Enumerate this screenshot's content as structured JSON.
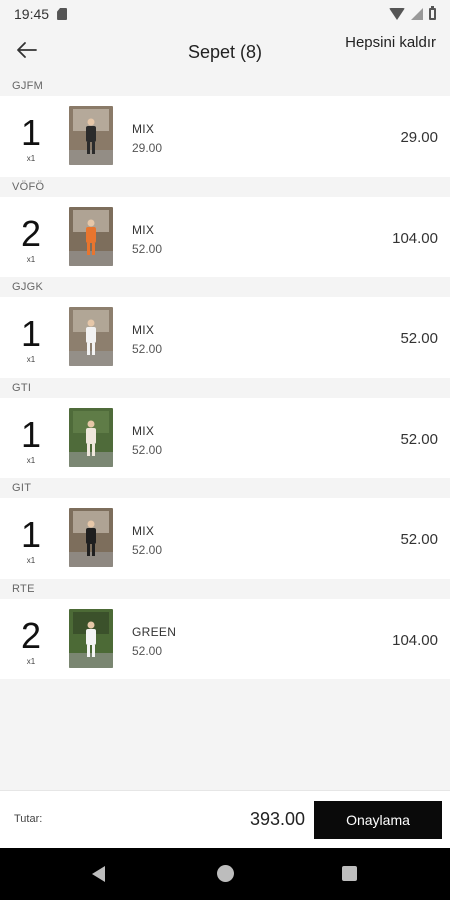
{
  "status_bar": {
    "time": "19:45",
    "icons": [
      "sd-card-icon",
      "wifi-icon",
      "signal-icon",
      "battery-icon"
    ]
  },
  "header": {
    "back_icon": "arrow-left-icon",
    "title": "Sepet (8)",
    "remove_all_label": "Hepsini kaldır"
  },
  "cart": {
    "groups": [
      {
        "code": "GJFM",
        "qty": "1",
        "qty_note": "x1",
        "variant": "MIX",
        "unit_price": "29.00",
        "total": "29.00"
      },
      {
        "code": "VÖFÖ",
        "qty": "2",
        "qty_note": "x1",
        "variant": "MIX",
        "unit_price": "52.00",
        "total": "104.00"
      },
      {
        "code": "GJGK",
        "qty": "1",
        "qty_note": "x1",
        "variant": "MIX",
        "unit_price": "52.00",
        "total": "52.00"
      },
      {
        "code": "GTI",
        "qty": "1",
        "qty_note": "x1",
        "variant": "MIX",
        "unit_price": "52.00",
        "total": "52.00"
      },
      {
        "code": "GIT",
        "qty": "1",
        "qty_note": "x1",
        "variant": "MIX",
        "unit_price": "52.00",
        "total": "52.00"
      },
      {
        "code": "RTE",
        "qty": "2",
        "qty_note": "x1",
        "variant": "GREEN",
        "unit_price": "52.00",
        "total": "104.00"
      }
    ]
  },
  "footer": {
    "total_label": "Tutar:",
    "total_value": "393.00",
    "confirm_label": "Onaylama"
  },
  "nav": {
    "icons": [
      "back-triangle-icon",
      "home-circle-icon",
      "recents-square-icon"
    ]
  },
  "colors": {
    "background": "#f4f4f4",
    "card": "#ffffff",
    "button": "#0a0a0a",
    "nav_bar": "#000000"
  }
}
